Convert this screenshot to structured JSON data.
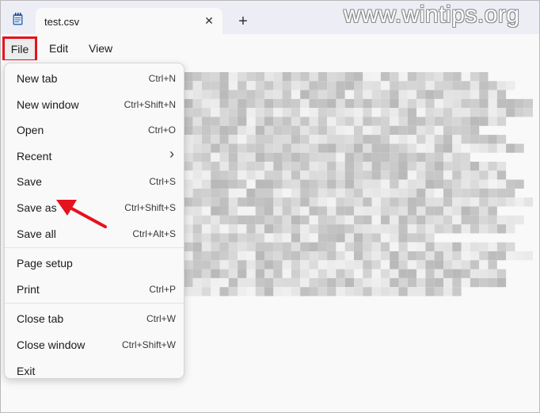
{
  "tab": {
    "title": "test.csv",
    "close_glyph": "✕",
    "new_tab_glyph": "+"
  },
  "watermark": "www.wintips.org",
  "menubar": {
    "file": "File",
    "edit": "Edit",
    "view": "View"
  },
  "file_menu": {
    "groups": [
      [
        {
          "label": "New tab",
          "shortcut": "Ctrl+N"
        },
        {
          "label": "New window",
          "shortcut": "Ctrl+Shift+N"
        },
        {
          "label": "Open",
          "shortcut": "Ctrl+O"
        },
        {
          "label": "Recent",
          "shortcut": "›"
        },
        {
          "label": "Save",
          "shortcut": "Ctrl+S"
        },
        {
          "label": "Save as",
          "shortcut": "Ctrl+Shift+S"
        },
        {
          "label": "Save all",
          "shortcut": "Ctrl+Alt+S"
        }
      ],
      [
        {
          "label": "Page setup",
          "shortcut": ""
        },
        {
          "label": "Print",
          "shortcut": "Ctrl+P"
        }
      ],
      [
        {
          "label": "Close tab",
          "shortcut": "Ctrl+W"
        },
        {
          "label": "Close window",
          "shortcut": "Ctrl+Shift+W"
        },
        {
          "label": "Exit",
          "shortcut": ""
        }
      ]
    ]
  },
  "colors": {
    "highlight_box": "#e5121f",
    "arrow": "#e5121f",
    "tabstrip": "#ededf6"
  },
  "icons": [
    "notepad-icon",
    "close-icon",
    "plus-icon",
    "chevron-right-icon",
    "red-pointer-arrow-icon"
  ]
}
